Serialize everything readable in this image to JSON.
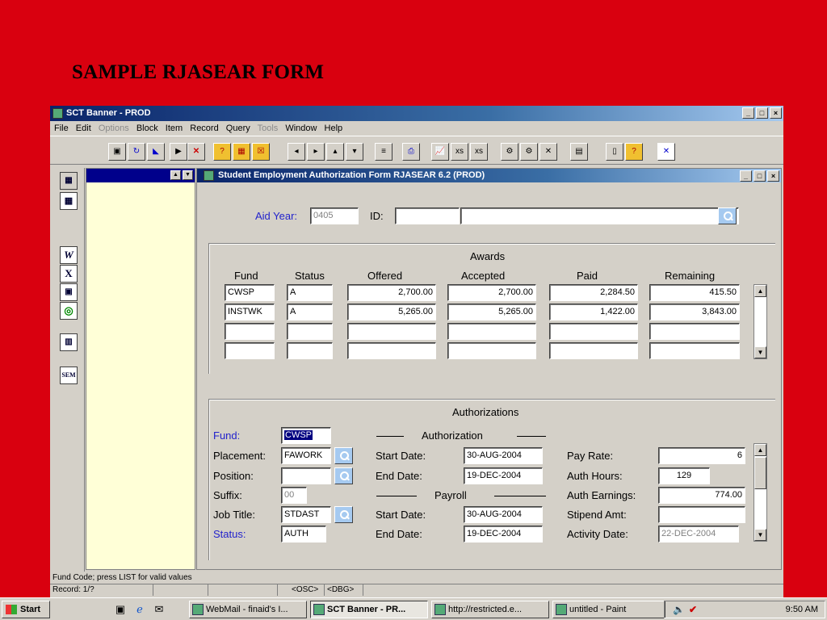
{
  "slide": {
    "title": "SAMPLE RJASEAR FORM"
  },
  "app": {
    "title": "SCT Banner - PROD",
    "menu": [
      {
        "label": "File",
        "enabled": true
      },
      {
        "label": "Edit",
        "enabled": true
      },
      {
        "label": "Options",
        "enabled": false
      },
      {
        "label": "Block",
        "enabled": true
      },
      {
        "label": "Item",
        "enabled": true
      },
      {
        "label": "Record",
        "enabled": true
      },
      {
        "label": "Query",
        "enabled": true
      },
      {
        "label": "Tools",
        "enabled": false
      },
      {
        "label": "Window",
        "enabled": true
      },
      {
        "label": "Help",
        "enabled": true
      }
    ]
  },
  "form": {
    "title": "Student Employment Authorization Form  RJASEAR  6.2  (PROD)",
    "aid_year_label": "Aid Year:",
    "aid_year_value": "0405",
    "id_label": "ID:",
    "id_value": "",
    "id_name": ""
  },
  "awards": {
    "title": "Awards",
    "headers": [
      "Fund",
      "Status",
      "Offered",
      "Accepted",
      "Paid",
      "Remaining"
    ],
    "rows": [
      {
        "fund": "CWSP",
        "status": "A",
        "offered": "2,700.00",
        "accepted": "2,700.00",
        "paid": "2,284.50",
        "remaining": "415.50"
      },
      {
        "fund": "INSTWK",
        "status": "A",
        "offered": "5,265.00",
        "accepted": "5,265.00",
        "paid": "1,422.00",
        "remaining": "3,843.00"
      },
      {
        "fund": "",
        "status": "",
        "offered": "",
        "accepted": "",
        "paid": "",
        "remaining": ""
      },
      {
        "fund": "",
        "status": "",
        "offered": "",
        "accepted": "",
        "paid": "",
        "remaining": ""
      }
    ]
  },
  "authorizations": {
    "title": "Authorizations",
    "fund_label": "Fund:",
    "fund_value": "CWSP",
    "placement_label": "Placement:",
    "placement_value": "FAWORK",
    "position_label": "Position:",
    "position_value": "",
    "suffix_label": "Suffix:",
    "suffix_value": "00",
    "job_title_label": "Job Title:",
    "job_title_value": "STDAST",
    "status_label": "Status:",
    "status_value": "AUTH",
    "authorization_heading": "Authorization",
    "auth_start_label": "Start Date:",
    "auth_start_value": "30-AUG-2004",
    "auth_end_label": "End Date:",
    "auth_end_value": "19-DEC-2004",
    "payroll_heading": "Payroll",
    "pay_start_label": "Start Date:",
    "pay_start_value": "30-AUG-2004",
    "pay_end_label": "End Date:",
    "pay_end_value": "19-DEC-2004",
    "pay_rate_label": "Pay Rate:",
    "pay_rate_value": "6",
    "auth_hours_label": "Auth Hours:",
    "auth_hours_value": "129",
    "auth_earnings_label": "Auth Earnings:",
    "auth_earnings_value": "774.00",
    "stipend_label": "Stipend Amt:",
    "stipend_value": "",
    "activity_date_label": "Activity Date:",
    "activity_date_value": "22-DEC-2004"
  },
  "status": {
    "message": "Fund Code; press LIST for valid values",
    "record": "Record: 1/?",
    "osc": "<OSC>",
    "dbg": "<DBG>"
  },
  "taskbar": {
    "start": "Start",
    "tasks": [
      "WebMail - finaid's I...",
      "SCT Banner - PR...",
      "http://restricted.e...",
      "untitled - Paint"
    ],
    "clock": "9:50 AM"
  }
}
